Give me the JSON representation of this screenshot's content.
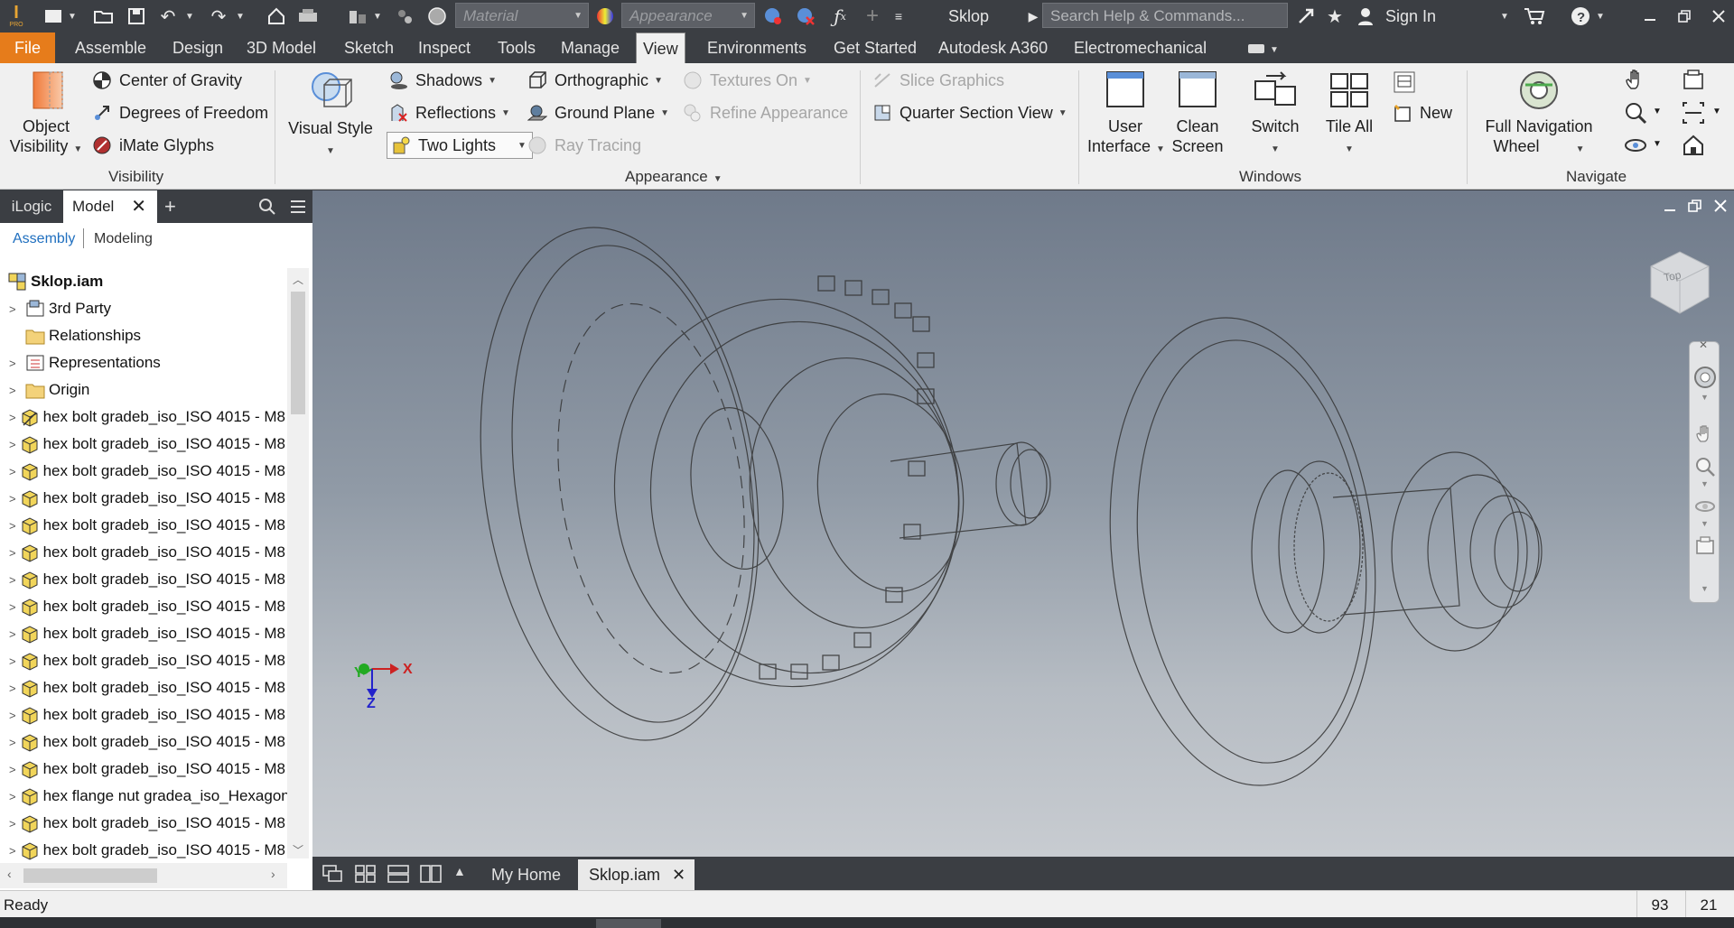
{
  "titlebar": {
    "app_icon_label": "I",
    "app_icon_sub": "PRO",
    "material_placeholder": "Material",
    "appearance_placeholder": "Appearance",
    "doc_title": "Sklop",
    "search_placeholder": "Search Help & Commands...",
    "sign_in": "Sign In"
  },
  "menu": {
    "tabs": [
      "File",
      "Assemble",
      "Design",
      "3D Model",
      "Sketch",
      "Inspect",
      "Tools",
      "Manage",
      "View",
      "Environments",
      "Get Started",
      "Autodesk A360",
      "Electromechanical"
    ],
    "active": "View"
  },
  "ribbon": {
    "visibility": {
      "object_visibility_line1": "Object",
      "object_visibility_line2": "Visibility",
      "center_of_gravity": "Center of Gravity",
      "degrees_of_freedom": "Degrees of Freedom",
      "imate_glyphs": "iMate Glyphs",
      "group_label": "Visibility"
    },
    "appearance": {
      "visual_style": "Visual Style",
      "shadows": "Shadows",
      "reflections": "Reflections",
      "two_lights": "Two Lights",
      "orthographic": "Orthographic",
      "ground_plane": "Ground Plane",
      "ray_tracing": "Ray Tracing",
      "textures_on": "Textures On",
      "refine_appearance": "Refine Appearance",
      "slice_graphics": "Slice Graphics",
      "quarter_section_view": "Quarter Section View",
      "group_label": "Appearance"
    },
    "windows": {
      "user_interface_line1": "User",
      "user_interface_line2": "Interface",
      "clean_screen_line1": "Clean",
      "clean_screen_line2": "Screen",
      "switch": "Switch",
      "tile_all": "Tile All",
      "new": "New",
      "group_label": "Windows"
    },
    "navigate": {
      "full_nav_wheel_line1": "Full Navigation",
      "full_nav_wheel_line2": "Wheel",
      "group_label": "Navigate"
    }
  },
  "browser": {
    "tabs": [
      "iLogic",
      "Model"
    ],
    "sub_tabs": [
      "Assembly",
      "Modeling"
    ],
    "root": "Sklop.iam",
    "items": [
      {
        "label": "3rd Party",
        "icon": "third-party-icon"
      },
      {
        "label": "Relationships",
        "icon": "folder-icon"
      },
      {
        "label": "Representations",
        "icon": "representations-icon"
      },
      {
        "label": "Origin",
        "icon": "folder-icon"
      },
      {
        "label": "hex bolt gradeb_iso_ISO 4015 - M8 :",
        "icon": "grounded-part-icon"
      },
      {
        "label": "hex bolt gradeb_iso_ISO 4015 - M8 :",
        "icon": "part-icon"
      },
      {
        "label": "hex bolt gradeb_iso_ISO 4015 - M8 :",
        "icon": "part-icon"
      },
      {
        "label": "hex bolt gradeb_iso_ISO 4015 - M8 :",
        "icon": "part-icon"
      },
      {
        "label": "hex bolt gradeb_iso_ISO 4015 - M8 :",
        "icon": "part-icon"
      },
      {
        "label": "hex bolt gradeb_iso_ISO 4015 - M8 :",
        "icon": "part-icon"
      },
      {
        "label": "hex bolt gradeb_iso_ISO 4015 - M8 :",
        "icon": "part-icon"
      },
      {
        "label": "hex bolt gradeb_iso_ISO 4015 - M8 :",
        "icon": "part-icon"
      },
      {
        "label": "hex bolt gradeb_iso_ISO 4015 - M8 :",
        "icon": "part-icon"
      },
      {
        "label": "hex bolt gradeb_iso_ISO 4015 - M8 :",
        "icon": "part-icon"
      },
      {
        "label": "hex bolt gradeb_iso_ISO 4015 - M8 :",
        "icon": "part-icon"
      },
      {
        "label": "hex bolt gradeb_iso_ISO 4015 - M8 :",
        "icon": "part-icon"
      },
      {
        "label": "hex bolt gradeb_iso_ISO 4015 - M8 :",
        "icon": "part-icon"
      },
      {
        "label": "hex bolt gradeb_iso_ISO 4015 - M8 :",
        "icon": "part-icon"
      },
      {
        "label": "hex flange nut gradea_iso_Hexagon",
        "icon": "part-icon"
      },
      {
        "label": "hex bolt gradeb_iso_ISO 4015 - M8 :",
        "icon": "part-icon"
      },
      {
        "label": "hex bolt gradeb_iso_ISO 4015 - M8 :",
        "icon": "part-icon"
      }
    ]
  },
  "viewport": {
    "viewcube_face": "Top",
    "triad": {
      "x": "X",
      "y": "Y",
      "z": "Z"
    }
  },
  "doc_tabs": {
    "home": "My Home",
    "active": "Sklop.iam"
  },
  "status": {
    "text": "Ready",
    "count1": "93",
    "count2": "21"
  },
  "colors": {
    "file_tab": "#e67c1b",
    "chrome_dark": "#3b3e43",
    "ribbon_bg": "#f0f0f0",
    "link_blue": "#1f6fbf"
  }
}
